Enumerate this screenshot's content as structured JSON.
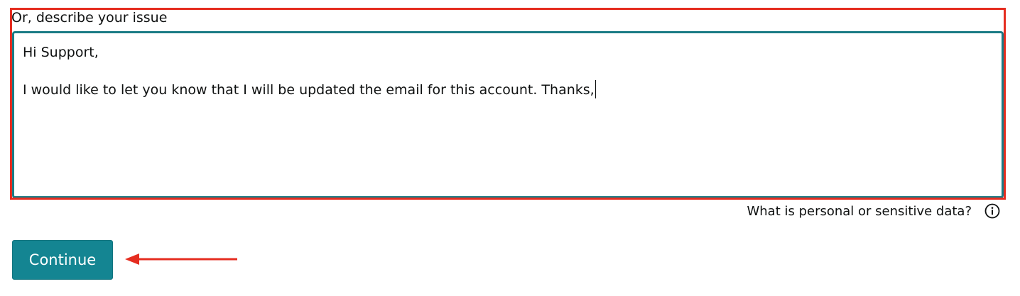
{
  "issue_form": {
    "label": "Or, describe your issue",
    "text_value": "Hi Support,\n\nI would like to let you know that I will be updated the email for this account. Thanks,"
  },
  "help": {
    "sensitive_data_link": "What is personal or sensitive data?",
    "icon": "info-icon"
  },
  "actions": {
    "continue_label": "Continue"
  },
  "colors": {
    "accent": "#148592",
    "input_border": "#1a7b85",
    "annotation": "#e52d20"
  }
}
